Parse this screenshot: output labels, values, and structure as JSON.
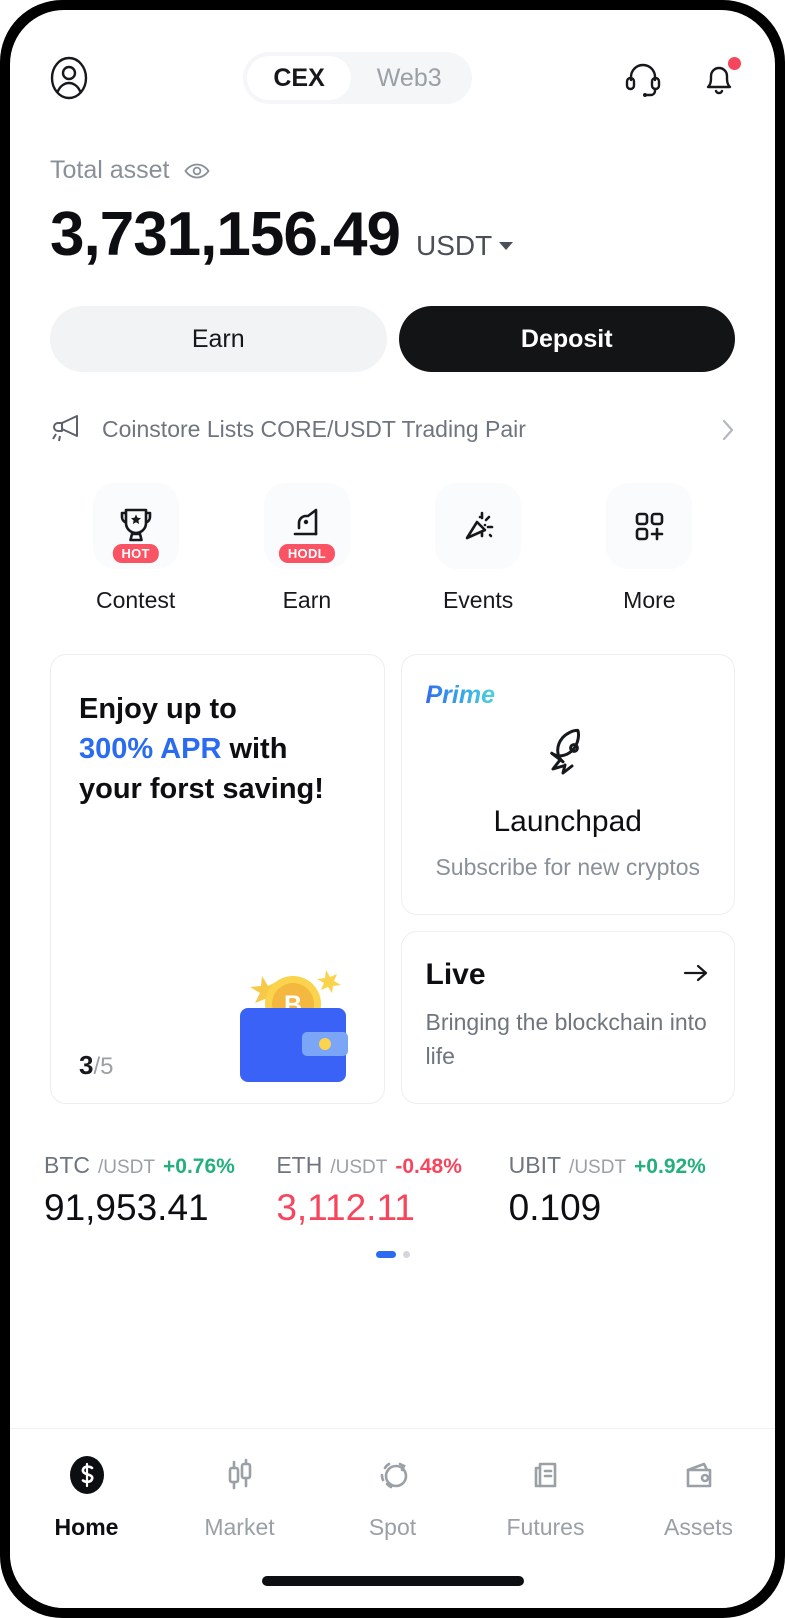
{
  "header": {
    "avatar_icon": "user-circle-icon",
    "tabs": [
      {
        "label": "CEX",
        "active": true
      },
      {
        "label": "Web3",
        "active": false
      }
    ],
    "support_icon": "headset-icon",
    "notification_icon": "bell-icon",
    "has_notification_dot": true
  },
  "asset": {
    "label": "Total asset",
    "visibility_icon": "eye-icon",
    "amount": "3,731,156.49",
    "currency": "USDT"
  },
  "actions": {
    "earn_label": "Earn",
    "deposit_label": "Deposit"
  },
  "announcement": {
    "icon": "megaphone-icon",
    "text": "Coinstore Lists CORE/USDT Trading Pair",
    "chevron_icon": "chevron-right-icon"
  },
  "quick_actions": [
    {
      "label": "Contest",
      "icon": "trophy-icon",
      "badge": "HOT"
    },
    {
      "label": "Earn",
      "icon": "piggy-hand-icon",
      "badge": "HODL"
    },
    {
      "label": "Events",
      "icon": "confetti-icon",
      "badge": ""
    },
    {
      "label": "More",
      "icon": "grid-plus-icon",
      "badge": ""
    }
  ],
  "promo_card": {
    "line1": "Enjoy up to",
    "highlight": "300% APR",
    "line2_rest": " with",
    "line3": "your forst saving!",
    "counter_current": "3",
    "counter_total": "/5",
    "art_icon": "wallet-coin-icon"
  },
  "prime_card": {
    "tag": "Prime",
    "icon": "rocket-icon",
    "title": "Launchpad",
    "subtitle": "Subscribe for new cryptos"
  },
  "live_card": {
    "title": "Live",
    "arrow_icon": "arrow-right-icon",
    "subtitle": "Bringing the blockchain into life"
  },
  "tickers": [
    {
      "base": "BTC",
      "quote": "/USDT",
      "change": "+0.76%",
      "price": "91,953.41",
      "direction": "up"
    },
    {
      "base": "ETH",
      "quote": "/USDT",
      "change": "-0.48%",
      "price": "3,112.11",
      "direction": "down"
    },
    {
      "base": "UBIT",
      "quote": "/USDT",
      "change": "+0.92%",
      "price": "0.109",
      "direction": "up"
    }
  ],
  "carousel": {
    "total": 2,
    "active_index": 0
  },
  "bottom_nav": [
    {
      "label": "Home",
      "icon": "coinstore-logo-icon",
      "active": true
    },
    {
      "label": "Market",
      "icon": "candlestick-icon",
      "active": false
    },
    {
      "label": "Spot",
      "icon": "swap-circles-icon",
      "active": false
    },
    {
      "label": "Futures",
      "icon": "document-chart-icon",
      "active": false
    },
    {
      "label": "Assets",
      "icon": "wallet-icon",
      "active": false
    }
  ],
  "colors": {
    "accent_blue": "#2a6bf2",
    "up_green": "#23b07c",
    "down_red": "#f6465d",
    "badge_red": "#fa5364",
    "primary_dark": "#131416"
  }
}
